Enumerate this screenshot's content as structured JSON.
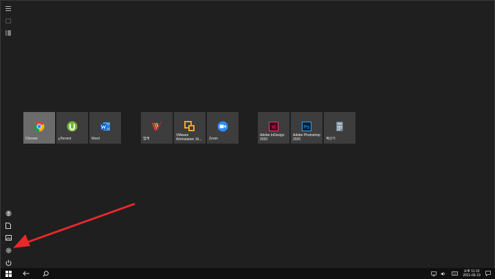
{
  "rail": {
    "top": [
      {
        "icon": "hamburger-menu-icon"
      },
      {
        "icon": "tile-grid-icon"
      },
      {
        "icon": "app-list-icon"
      }
    ],
    "bottom": [
      {
        "icon": "user-avatar-icon"
      },
      {
        "icon": "documents-icon"
      },
      {
        "icon": "pictures-icon"
      },
      {
        "icon": "settings-gear-icon"
      },
      {
        "icon": "power-icon"
      }
    ]
  },
  "tiles": {
    "chrome": {
      "label": "Chrome",
      "icon": "chrome-icon",
      "selected": true
    },
    "utorrent": {
      "label": "µTorrent",
      "icon": "utorrent-icon"
    },
    "word": {
      "label": "Word",
      "icon": "word-icon"
    },
    "app4": {
      "label": "앱캐",
      "icon": "vivaldi-like-icon"
    },
    "vmware": {
      "label": "VMware Workstation 16...",
      "icon": "vmware-icon"
    },
    "zoom": {
      "label": "Zoom",
      "icon": "zoom-icon"
    },
    "indesign": {
      "label": "Adobe InDesign 2020",
      "icon": "indesign-icon",
      "glyph": "Id"
    },
    "photoshop": {
      "label": "Adobe Photoshop 2020",
      "icon": "photoshop-icon",
      "glyph": "Ps"
    },
    "calculator": {
      "label": "계산기",
      "icon": "calculator-icon"
    }
  },
  "taskbar": {
    "icons": [
      "windows-start-icon",
      "back-arrow-icon",
      "search-icon"
    ],
    "tray_icons": [
      "network-icon",
      "volume-icon",
      "keyboard-icon",
      "notification-icon"
    ],
    "clock_line1": "오후 11:10",
    "clock_line2": "2021-06-19"
  },
  "colors": {
    "background": "#1f1f1f",
    "tile": "#3d3d3d",
    "tile_selected": "#6b6b6b",
    "taskbar": "#101010",
    "annotation_arrow": "#e8282b"
  }
}
